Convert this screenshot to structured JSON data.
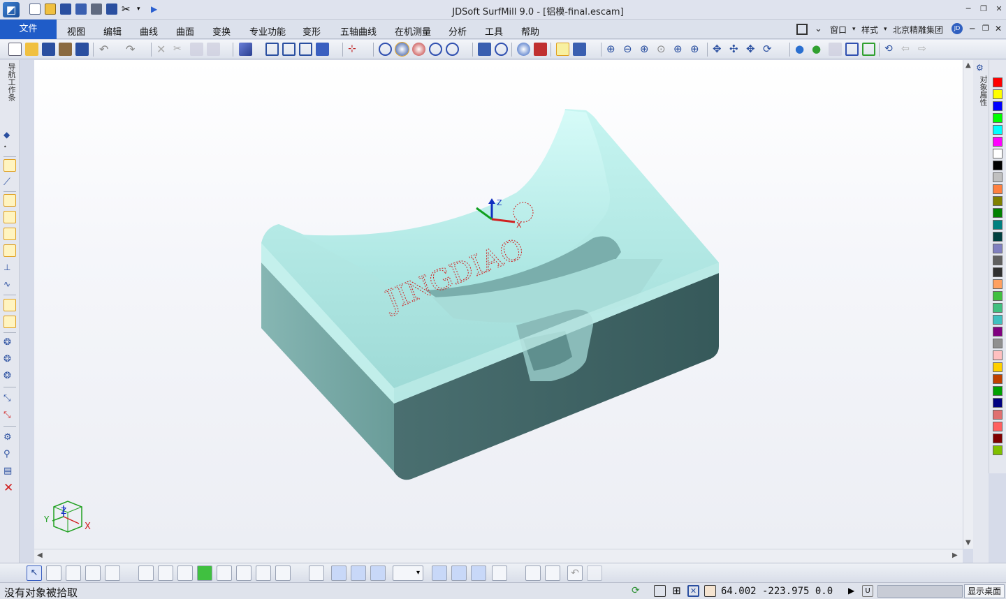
{
  "titlebar": {
    "logo_icon": "jdsoft-logo-icon",
    "title": "JDSoft SurfMill 9.0 - [铝模-final.escam]",
    "quick_access": [
      "new-file-icon",
      "open-folder-icon",
      "save-icon",
      "save-as-icon",
      "print-icon",
      "save-all-icon",
      "scissors-icon",
      "dropdown-arrow-icon",
      "run-icon"
    ],
    "window_controls": [
      "minimize-icon",
      "restore-icon",
      "close-icon"
    ]
  },
  "menubar": {
    "file_tab": "文件",
    "items": [
      "视图",
      "编辑",
      "曲线",
      "曲面",
      "变换",
      "专业功能",
      "变形",
      "五轴曲线",
      "在机测量",
      "分析",
      "工具",
      "帮助"
    ],
    "right": {
      "window": "窗口",
      "style": "样式",
      "company": "北京精雕集团",
      "user_badge": "JD"
    }
  },
  "left_panel": {
    "label": "导航工作条"
  },
  "right_panel": {
    "label": "对象属性"
  },
  "viewport": {
    "model_text": "JINGDIAO",
    "triad_labels": {
      "z": "Z",
      "x": "X"
    },
    "corner_axis": {
      "x": "X",
      "y": "Y",
      "z": "Z"
    }
  },
  "palette": {
    "colors": [
      "#ff0000",
      "#ffff00",
      "#0000ff",
      "#00ff00",
      "#00ffff",
      "#ff00ff",
      "#ffffff",
      "#000000",
      "#c0c0c0",
      "#ff8040",
      "#808000",
      "#008000",
      "#008080",
      "#004040",
      "#8080c0",
      "#606060",
      "#303030",
      "#ffa060",
      "#40c040",
      "#40c080",
      "#40c0c0",
      "#800080",
      "#909090",
      "#ffc0c0",
      "#ffd000",
      "#c04000",
      "#00a000",
      "#000080",
      "#e07070",
      "#ff6060",
      "#800000",
      "#80c000"
    ]
  },
  "status": {
    "message": "没有对象被拾取",
    "coordinates": "64.002 -223.975 0.0",
    "u_label": "U",
    "show_desktop": "显示桌面"
  },
  "colors": {
    "accent": "#1f5cc8",
    "model_top": "#b8f0ec",
    "model_side_light": "#7aa8a6",
    "model_side_dark": "#3d5d5e",
    "engraving": "#d02020"
  }
}
